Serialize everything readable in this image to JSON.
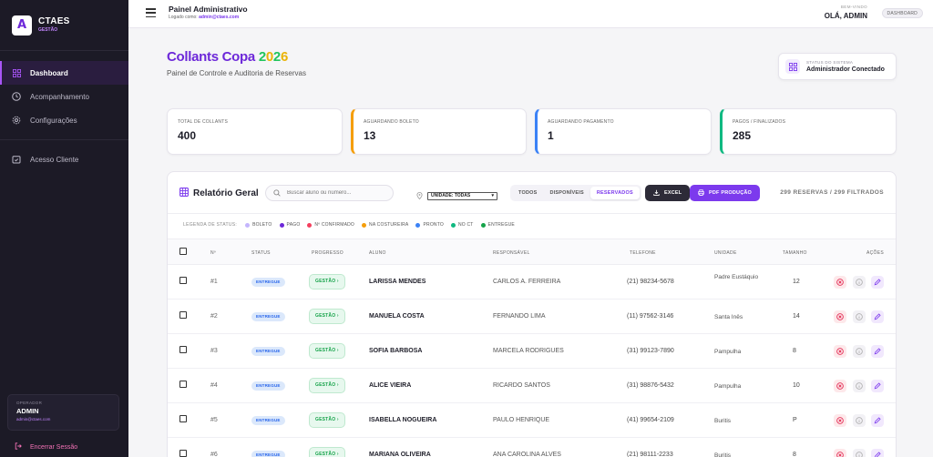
{
  "brand": {
    "logo_letter": "A",
    "name": "CTAES",
    "sub": "GESTÃO"
  },
  "sidebar": {
    "items": [
      {
        "label": "Dashboard",
        "icon": "grid-icon",
        "active": true
      },
      {
        "label": "Acompanhamento",
        "icon": "clock-icon"
      },
      {
        "label": "Configurações",
        "icon": "gear-icon"
      },
      {
        "label": "Acesso Cliente",
        "icon": "calendar-icon"
      }
    ],
    "operator_label": "OPERADOR",
    "operator_name": "ADMIN",
    "operator_email": "admin@ctaes.com",
    "logout_label": "Encerrar Sessão"
  },
  "topbar": {
    "title": "Painel Administrativo",
    "logged_prefix": "Logado como: ",
    "logged_email": "admin@ctaes.com",
    "welcome": "BEM-VINDO",
    "user_greeting": "OLÁ, ADMIN",
    "badge": "DASHBOARD"
  },
  "header": {
    "title_main": "Collants Copa ",
    "title_year": [
      "2",
      "0",
      "2",
      "6"
    ],
    "subtitle": "Painel de Controle e Auditoria de Reservas",
    "status_label": "STATUS DO SISTEMA",
    "status_value": "Administrador Conectado"
  },
  "stats": [
    {
      "label": "TOTAL DE COLLANTS",
      "value": "400"
    },
    {
      "label": "AGUARDANDO BOLETO",
      "value": "13"
    },
    {
      "label": "AGUARDANDO PAGAMENTO",
      "value": "1"
    },
    {
      "label": "PAGOS / FINALIZADOS",
      "value": "285"
    }
  ],
  "report": {
    "title": "Relatório Geral",
    "search_placeholder": "Buscar aluno ou número...",
    "unit_filter": "UNIDADE: TODAS",
    "segments": [
      "TODOS",
      "DISPONÍVEIS",
      "RESERVADOS"
    ],
    "active_segment": "RESERVADOS",
    "excel_label": "EXCEL",
    "pdf_label": "PDF PRODUÇÃO",
    "count": "299 RESERVAS / 299 FILTRADOS",
    "legend_title": "LEGENDA DE STATUS:",
    "legend": [
      {
        "label": "BOLETO",
        "color": "#c4b5fd"
      },
      {
        "label": "PAGO",
        "color": "#6d28d9"
      },
      {
        "label": "Nº CONFIRMADO",
        "color": "#f43f5e"
      },
      {
        "label": "NA COSTUREIRA",
        "color": "#f59e0b"
      },
      {
        "label": "PRONTO",
        "color": "#3b82f6"
      },
      {
        "label": "NO CT",
        "color": "#10b981"
      },
      {
        "label": "ENTREGUE",
        "color": "#16a34a"
      }
    ],
    "columns": [
      "Nº",
      "STATUS",
      "PROGRESSO",
      "ALUNO",
      "RESPONSÁVEL",
      "TELEFONE",
      "UNIDADE",
      "TAMANHO",
      "AÇÕES"
    ],
    "rows": [
      {
        "num": "#1",
        "status": "ENTREGUE",
        "progress": "GESTÃO",
        "aluno": "LARISSA MENDES",
        "resp": "CARLOS A. FERREIRA",
        "tel": "(21) 98234-5678",
        "unidade": "Padre Eustáquio",
        "tamanho": "12"
      },
      {
        "num": "#2",
        "status": "ENTREGUE",
        "progress": "GESTÃO",
        "aluno": "MANUELA COSTA",
        "resp": "FERNANDO LIMA",
        "tel": "(11) 97562-3146",
        "unidade": "Santa Inês",
        "tamanho": "14"
      },
      {
        "num": "#3",
        "status": "ENTREGUE",
        "progress": "GESTÃO",
        "aluno": "SOFIA BARBOSA",
        "resp": "MARCELA RODRIGUES",
        "tel": "(31) 99123-7890",
        "unidade": "Pampulha",
        "tamanho": "8"
      },
      {
        "num": "#4",
        "status": "ENTREGUE",
        "progress": "GESTÃO",
        "aluno": "ALICE VIEIRA",
        "resp": "RICARDO SANTOS",
        "tel": "(31) 98876-5432",
        "unidade": "Pampulha",
        "tamanho": "10"
      },
      {
        "num": "#5",
        "status": "ENTREGUE",
        "progress": "GESTÃO",
        "aluno": "ISABELLA NOGUEIRA",
        "resp": "PAULO HENRIQUE",
        "tel": "(41) 99654-2109",
        "unidade": "Buritis",
        "tamanho": "P"
      },
      {
        "num": "#6",
        "status": "ENTREGUE",
        "progress": "GESTÃO",
        "aluno": "MARIANA OLIVEIRA",
        "resp": "ANA CAROLINA ALVES",
        "tel": "(21) 98111-2233",
        "unidade": "Buritis",
        "tamanho": "8"
      }
    ]
  }
}
